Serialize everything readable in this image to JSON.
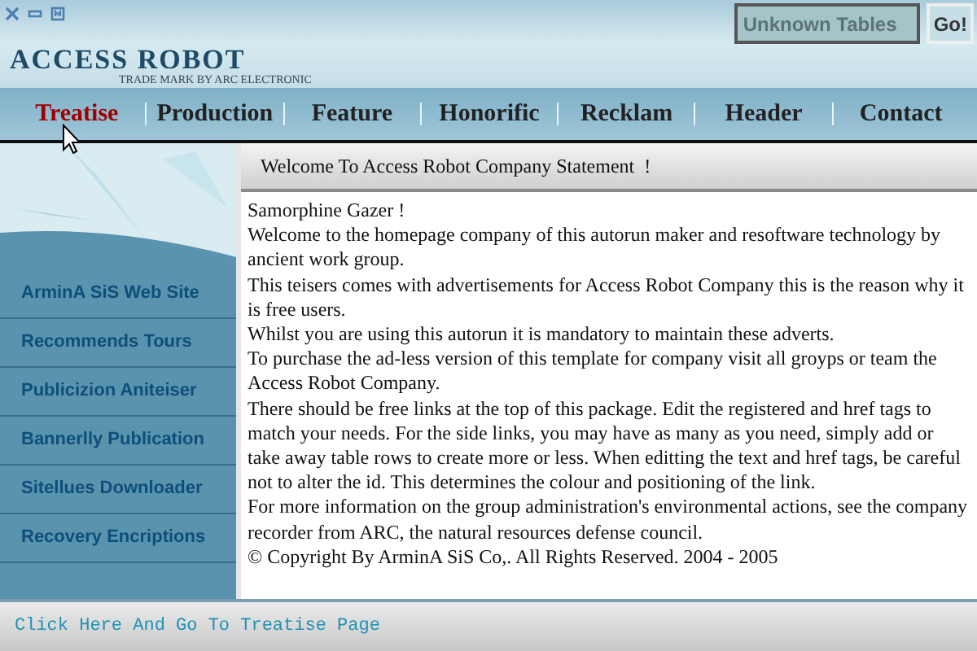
{
  "search": {
    "value": "Unknown Tables",
    "button": "Go!"
  },
  "logo": {
    "title": "ACCESS ROBOT",
    "subtitle": "TRADE MARK BY ARC ELECTRONIC"
  },
  "nav": [
    {
      "label": "Treatise",
      "selected": true
    },
    {
      "label": "Production",
      "selected": false
    },
    {
      "label": "Feature",
      "selected": false
    },
    {
      "label": "Honorific",
      "selected": false
    },
    {
      "label": "Recklam",
      "selected": false
    },
    {
      "label": "Header",
      "selected": false
    },
    {
      "label": "Contact",
      "selected": false
    }
  ],
  "sidebar": [
    "ArminA SiS Web Site",
    "Recommends Tours",
    "Publicizion Aniteiser",
    "Bannerlly Publication",
    "Sitellues Downloader",
    "Recovery Encriptions"
  ],
  "content": {
    "title": "Welcome To Access Robot Company Statement  !",
    "paragraphs": [
      "Samorphine Gazer !",
      "Welcome to the homepage company of this autorun maker and resoftware technology by ancient work group.",
      "This teisers comes with advertisements for Access Robot Company this is the reason why it is free users.",
      "Whilst you are using this autorun it is mandatory to maintain these adverts.",
      "To purchase the ad-less version of this template for company visit all groyps or team the Access Robot Company.",
      "There should be free links at the top of this package. Edit the registered and href tags to match your needs. For the side links, you may have as many as you need, simply add or take away table rows to create more or less. When editting the text and href tags, be careful not to alter the id. This determines the colour and positioning of the link.",
      "For more information on the group administration's environmental actions, see the company recorder from ARC, the natural resources defense council.",
      "© Copyright By ArminA SiS Co,. All Rights Reserved. 2004 - 2005"
    ]
  },
  "footer": {
    "link": "Click Here And Go To Treatise Page"
  }
}
